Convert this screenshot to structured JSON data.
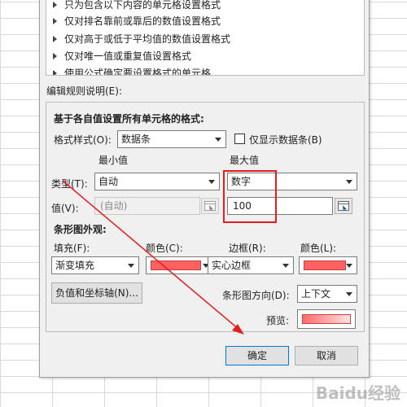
{
  "rules_list": [
    "只为包含以下内容的单元格设置格式",
    "仅对排名靠前或靠后的数值设置格式",
    "仅对高于或低于平均值的数值设置格式",
    "仅对唯一值或重复值设置格式",
    "使用公式确定要设置格式的单元格"
  ],
  "edit_description_label": "编辑规则说明(E):",
  "panel": {
    "heading": "基于各自值设置所有单元格的格式:",
    "format_style_label": "格式样式(O):",
    "format_style_value": "数据条",
    "show_bar_only_label": "仅显示数据条(B)",
    "min_header": "最小值",
    "max_header": "最大值",
    "type_label": "类型(T):",
    "min_type": "自动",
    "max_type": "数字",
    "value_label": "值(V):",
    "min_value": "(自动)",
    "max_value": "100",
    "bar_appearance_heading": "条形图外观:",
    "fill_label": "填充(F):",
    "fill_value": "渐变填充",
    "fill_color_label": "颜色(C):",
    "border_label": "边框(R):",
    "border_value": "实心边框",
    "border_color_label": "颜色(L):",
    "negative_axis_button": "负值和坐标轴(N)...",
    "bar_direction_label": "条形图方向(D):",
    "bar_direction_value": "上下文",
    "preview_label": "预览:"
  },
  "buttons": {
    "ok": "确定",
    "cancel": "取消"
  },
  "watermark": "Baidu经验",
  "colors": {
    "bar_color": "#ff6060",
    "highlight": "#e41e1e",
    "accent": "#0078d7"
  }
}
